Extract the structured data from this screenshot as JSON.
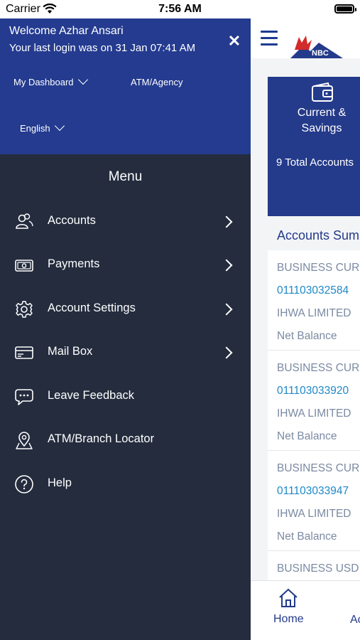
{
  "status_bar": {
    "carrier": "Carrier",
    "time": "7:56 AM"
  },
  "drawer": {
    "welcome": "Welcome Azhar Ansari",
    "last_login": "Your last login was on 31 Jan 07:41 AM",
    "close_icon": "✕",
    "links": {
      "dashboard": "My Dashboard",
      "atm_agency": "ATM/Agency",
      "language": "English"
    },
    "menu_title": "Menu",
    "menu": [
      {
        "label": "Accounts",
        "icon": "users-icon"
      },
      {
        "label": "Payments",
        "icon": "cash-icon"
      },
      {
        "label": "Account Settings",
        "icon": "gear-icon"
      },
      {
        "label": "Mail Box",
        "icon": "mailbox-icon"
      },
      {
        "label": "Leave Feedback",
        "icon": "feedback-icon"
      },
      {
        "label": "ATM/Branch Locator",
        "icon": "location-icon"
      },
      {
        "label": "Help",
        "icon": "help-icon"
      }
    ]
  },
  "main": {
    "logo_text": "NBC",
    "card": {
      "label_line1": "Current &",
      "label_line2": "Savings",
      "count": "9 Total Accounts"
    },
    "section_title": "Accounts Summary",
    "accounts": [
      {
        "type": "BUSINESS CURRENT",
        "number": "011103032584",
        "name": "IHWA LIMITED",
        "balance_label": "Net Balance"
      },
      {
        "type": "BUSINESS CURRENT",
        "number": "011103033920",
        "name": "IHWA LIMITED",
        "balance_label": "Net Balance"
      },
      {
        "type": "BUSINESS CURRENT",
        "number": "011103033947",
        "name": "IHWA LIMITED",
        "balance_label": "Net Balance"
      },
      {
        "type": "BUSINESS USD C"
      }
    ],
    "nav": {
      "home": "Home",
      "next": "Ac"
    }
  },
  "colors": {
    "drawer_header": "#243b8f",
    "drawer_body": "#242c3e",
    "accent_link": "#1e88c8"
  }
}
